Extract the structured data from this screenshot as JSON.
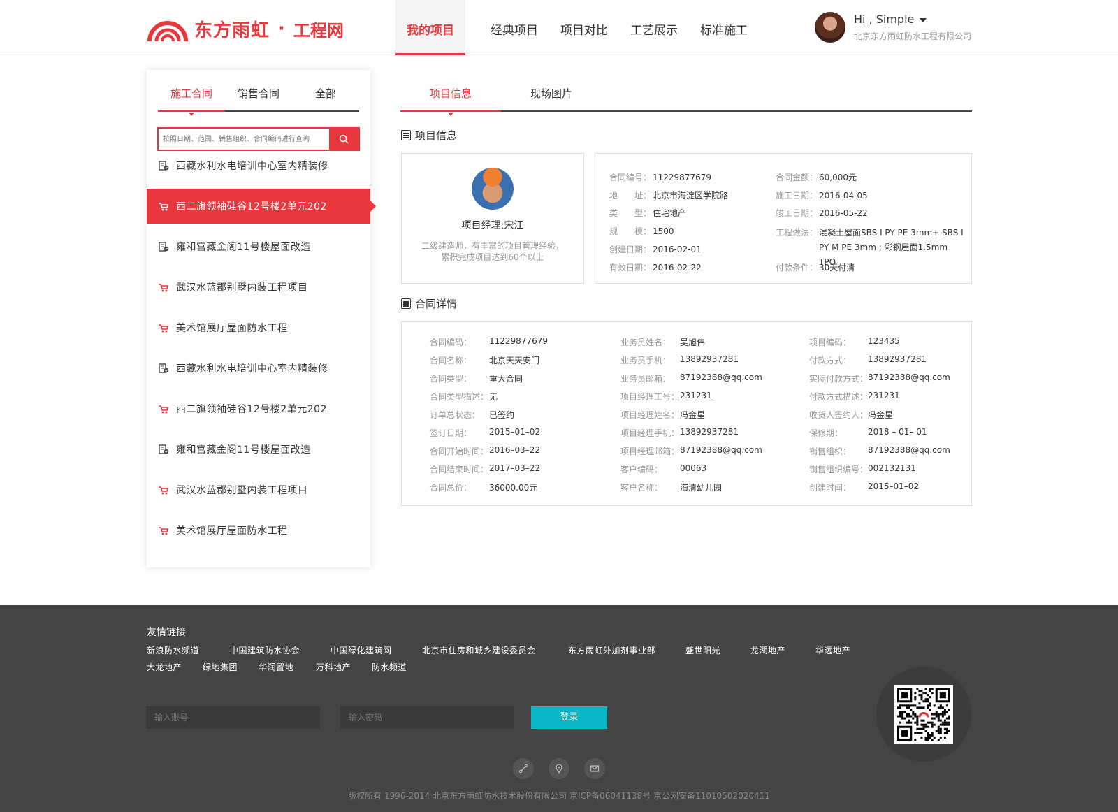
{
  "header": {
    "brand": "东方雨虹",
    "separator": "·",
    "site": "工程网",
    "nav": [
      "我的项目",
      "经典项目",
      "项目对比",
      "工艺展示",
      "标准施工"
    ],
    "user": {
      "greeting": "Hi , Simple",
      "company": "北京东方雨虹防水工程有限公司"
    }
  },
  "left": {
    "tabs": [
      "施工合同",
      "销售合同",
      "全部"
    ],
    "search_placeholder": "按照日期、范围、销售组织、合同编码进行查询",
    "projects": [
      {
        "name": "西藏水利水电培训中心室内精装修",
        "icon": "doc-check-icon"
      },
      {
        "name": "西二旗领袖硅谷12号楼2单元202",
        "icon": "wheelbarrow-icon"
      },
      {
        "name": "雍和宫藏金阁11号楼屋面改造",
        "icon": "doc-check-icon"
      },
      {
        "name": "武汉水蓝郡别墅内装工程项目",
        "icon": "wheelbarrow-icon"
      },
      {
        "name": "美术馆展厅屋面防水工程",
        "icon": "wheelbarrow-icon"
      },
      {
        "name": "西藏水利水电培训中心室内精装修",
        "icon": "doc-check-icon"
      },
      {
        "name": "西二旗领袖硅谷12号楼2单元202",
        "icon": "wheelbarrow-icon"
      },
      {
        "name": "雍和宫藏金阁11号楼屋面改造",
        "icon": "doc-check-icon"
      },
      {
        "name": "武汉水蓝郡别墅内装工程项目",
        "icon": "wheelbarrow-icon"
      },
      {
        "name": "美术馆展厅屋面防水工程",
        "icon": "wheelbarrow-icon"
      }
    ]
  },
  "right": {
    "tabs": [
      "项目信息",
      "现场图片"
    ],
    "section1": "项目信息",
    "section2": "合同详情",
    "manager": {
      "name": "项目经理:宋江",
      "desc": "二级建造师，有丰富的项目管理经验，累积完成项目达到60个以上"
    },
    "info_left": [
      {
        "k": "合同编号：",
        "v": "11229877679"
      },
      {
        "k": "地　　址：",
        "v": "北京市海淀区学院路"
      },
      {
        "k": "类　　型：",
        "v": "住宅地产"
      },
      {
        "k": "规　　模：",
        "v": "1500"
      },
      {
        "k": "创建日期：",
        "v": "2016-02-01"
      },
      {
        "k": "有效日期：",
        "v": "2016-02-22"
      }
    ],
    "info_right": [
      {
        "k": "合同金额：",
        "v": "60,000元"
      },
      {
        "k": "施工日期：",
        "v": "2016-04-05"
      },
      {
        "k": "竣工日期：",
        "v": "2016-05-22"
      },
      {
        "k": "工程做法：",
        "v": "混凝土屋面SBS I PY PE 3mm+  SBS I PY M PE 3mm ; 彩钢屋面1.5mm TPO"
      },
      {
        "k": "付款条件：",
        "v": "30天付清"
      }
    ],
    "contract_col1": [
      {
        "k": "合同编码：",
        "v": "11229877679"
      },
      {
        "k": "合同名称：",
        "v": "北京天天安门"
      },
      {
        "k": "合同类型：",
        "v": "重大合同"
      },
      {
        "k": "合同类型描述：",
        "v": "无"
      },
      {
        "k": "订单总状态：",
        "v": "已签约"
      },
      {
        "k": "签订日期：",
        "v": "2015–01–02"
      },
      {
        "k": "合同开始时间：",
        "v": "2016–03–22"
      },
      {
        "k": "合同结束时间：",
        "v": "2017–03–22"
      },
      {
        "k": "合同总价：",
        "v": "36000.00元"
      }
    ],
    "contract_col2": [
      {
        "k": "业务员姓名：",
        "v": "吴旭伟"
      },
      {
        "k": "业务员手机：",
        "v": "13892937281"
      },
      {
        "k": "业务员邮箱：",
        "v": "87192388@qq.com"
      },
      {
        "k": "项目经理工号：",
        "v": "231231"
      },
      {
        "k": "项目经理姓名：",
        "v": "冯金星"
      },
      {
        "k": "项目经理手机：",
        "v": "13892937281"
      },
      {
        "k": "项目经理邮箱：",
        "v": "87192388@qq.com"
      },
      {
        "k": "客户编码：",
        "v": "00063"
      },
      {
        "k": "客户名称：",
        "v": "海清幼儿园"
      }
    ],
    "contract_col3": [
      {
        "k": "项目编码：",
        "v": "123435"
      },
      {
        "k": "付款方式：",
        "v": "13892937281"
      },
      {
        "k": "实际付款方式：",
        "v": "87192388@qq.com"
      },
      {
        "k": "付款方式描述：",
        "v": "231231"
      },
      {
        "k": "收货人签约人：",
        "v": "冯金星"
      },
      {
        "k": "保修期：",
        "v": "2018 – 01– 01"
      },
      {
        "k": "销售组织：",
        "v": "87192388@qq.com"
      },
      {
        "k": "销售组织编号：",
        "v": "002132131"
      },
      {
        "k": "创建时间：",
        "v": "2015–01–02"
      }
    ]
  },
  "footer": {
    "title": "友情链接",
    "links_row1": [
      "新浪防水频道",
      "中国建筑防水协会",
      "中国绿化建筑网",
      "北京市住房和城乡建设委员会",
      "东方雨虹外加剂事业部",
      "盛世阳光",
      "龙湖地产",
      "华远地产"
    ],
    "links_row2": [
      "大龙地产",
      "绿地集团",
      "华润置地",
      "万科地产",
      "防水频道"
    ],
    "account_placeholder": "输入账号",
    "password_placeholder": "输入密码",
    "login": "登录",
    "copyright": "版权所有 1996-2014 北京东方雨虹防水技术股份有限公司   京ICP备06041138号   京公网安备11010502020411"
  },
  "colors": {
    "accent": "#e8383d",
    "footer_bg": "#444444",
    "login_btn": "#0ab8c8"
  }
}
